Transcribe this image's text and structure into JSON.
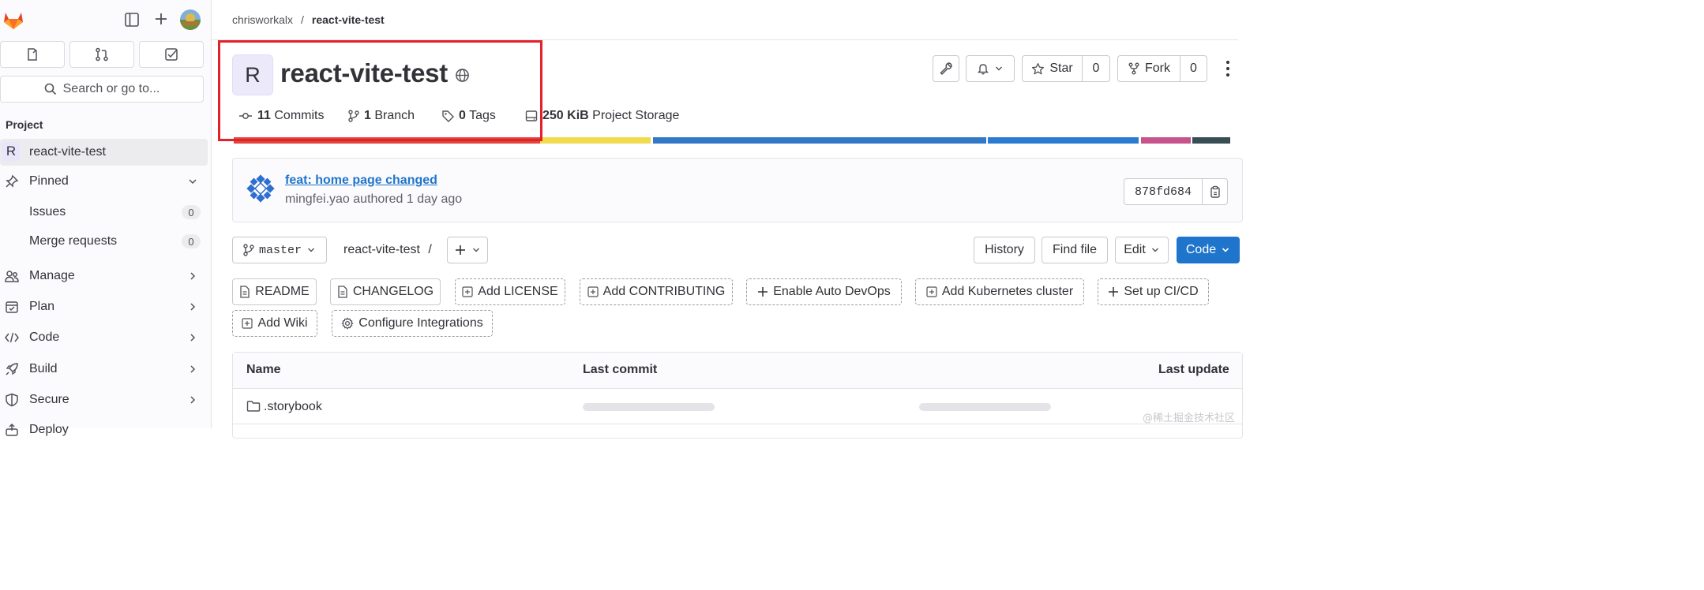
{
  "sidebar": {
    "search_label": "Search or go to...",
    "section_label": "Project",
    "project_item": {
      "initial": "R",
      "label": "react-vite-test"
    },
    "pinned_label": "Pinned",
    "pinned_items": [
      {
        "label": "Issues",
        "count": "0"
      },
      {
        "label": "Merge requests",
        "count": "0"
      }
    ],
    "nav_items": [
      {
        "label": "Manage",
        "icon": "users-icon"
      },
      {
        "label": "Plan",
        "icon": "calendar-icon"
      },
      {
        "label": "Code",
        "icon": "code-icon"
      },
      {
        "label": "Build",
        "icon": "rocket-icon"
      },
      {
        "label": "Secure",
        "icon": "shield-icon"
      },
      {
        "label": "Deploy",
        "icon": "deploy-icon"
      }
    ]
  },
  "breadcrumb": {
    "parent": "chrisworkalx",
    "separator": "/",
    "current": "react-vite-test"
  },
  "project": {
    "initial": "R",
    "title": "react-vite-test",
    "stats": {
      "commits_count": "11",
      "commits_label": "Commits",
      "branch_count": "1",
      "branch_label": "Branch",
      "tags_count": "0",
      "tags_label": "Tags",
      "storage_size": "250 KiB",
      "storage_label": "Project Storage"
    }
  },
  "header_actions": {
    "star_label": "Star",
    "star_count": "0",
    "fork_label": "Fork",
    "fork_count": "0"
  },
  "language_bar_colors": [
    "#e0473c",
    "#f0dc4e",
    "#3178c6",
    "#2b7bd1",
    "#c6538c",
    "#384d54"
  ],
  "last_commit": {
    "title": "feat: home page changed",
    "author": "mingfei.yao",
    "authored_text": "authored 1 day ago",
    "sha": "878fd684"
  },
  "repo_toolbar": {
    "branch": "master",
    "path": "react-vite-test",
    "path_sep": "/",
    "history_label": "History",
    "find_file_label": "Find file",
    "edit_label": "Edit",
    "code_label": "Code"
  },
  "quick_links": {
    "readme": "README",
    "changelog": "CHANGELOG",
    "add_license": "Add LICENSE",
    "add_contributing": "Add CONTRIBUTING",
    "enable_devops": "Enable Auto DevOps",
    "add_k8s": "Add Kubernetes cluster",
    "setup_ci": "Set up CI/CD",
    "add_wiki": "Add Wiki",
    "configure_integrations": "Configure Integrations"
  },
  "file_table": {
    "col_name": "Name",
    "col_last_commit": "Last commit",
    "col_last_update": "Last update",
    "rows": [
      {
        "name": ".storybook"
      }
    ]
  },
  "watermark": "@稀土掘金技术社区",
  "accent_color": "#1f75cb",
  "highlight_color": "#e4212a"
}
